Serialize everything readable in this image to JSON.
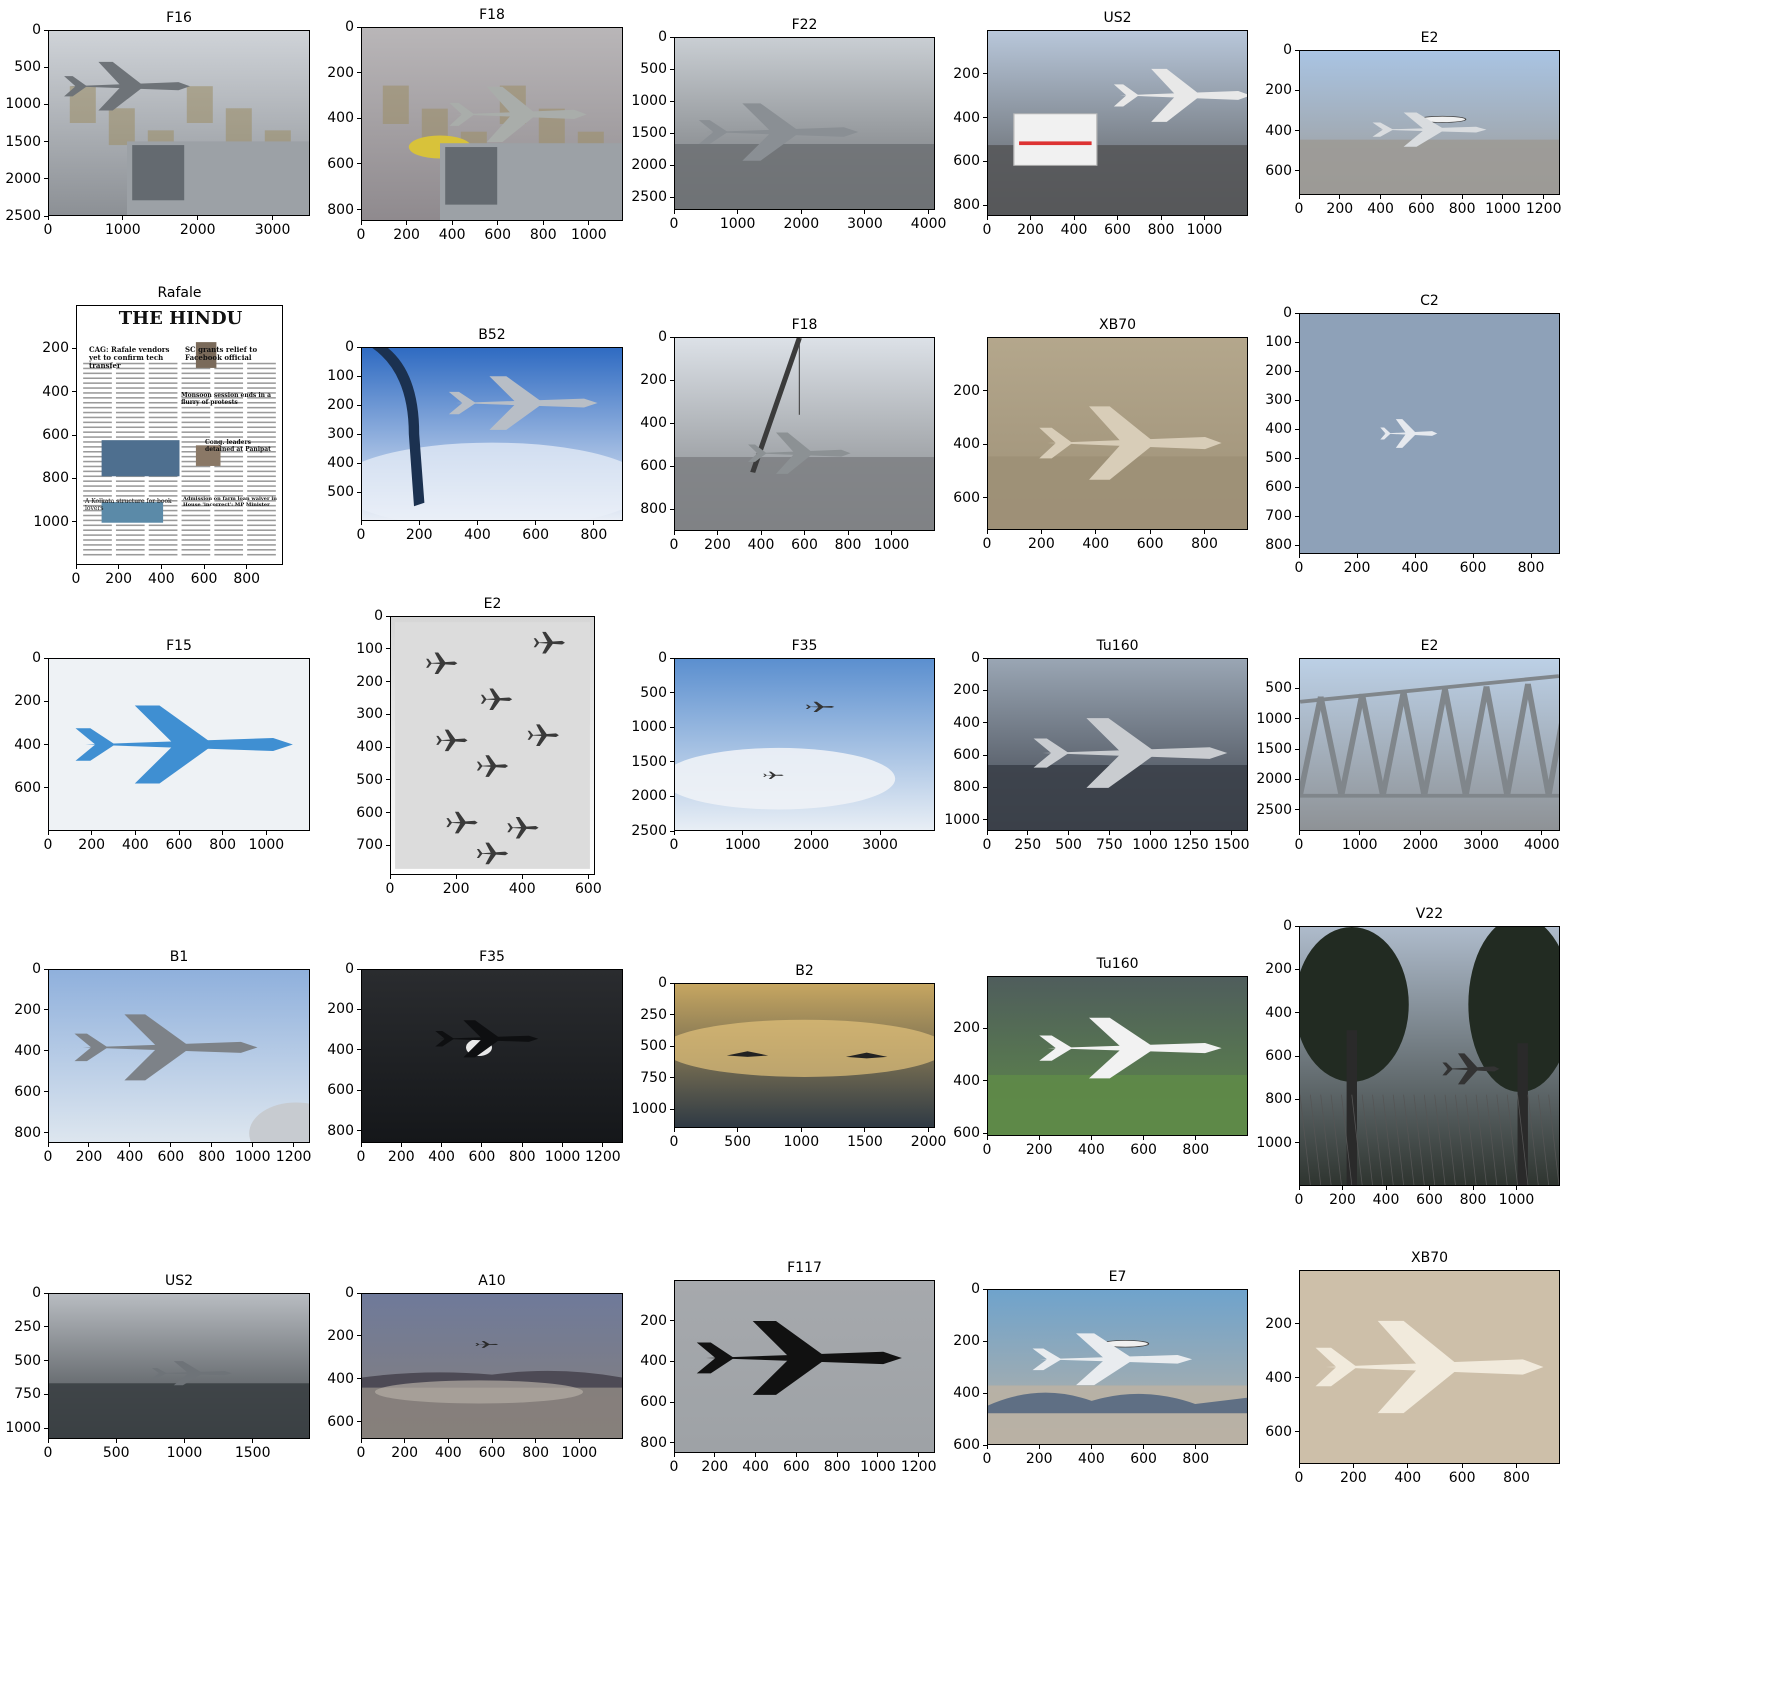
{
  "panels": [
    {
      "title": "F16",
      "x_ticks": [
        "0",
        "1000",
        "2000",
        "3000"
      ],
      "y_ticks": [
        "0",
        "500",
        "1000",
        "1500",
        "2000",
        "2500"
      ],
      "image_size": [
        3500,
        2500
      ],
      "palette": {
        "sky": "#cfd3d8",
        "ground": "#8c9095",
        "subject": "#6e7378"
      },
      "subject": "jet-fighter-in-hangar-icon"
    },
    {
      "title": "F18",
      "x_ticks": [
        "0",
        "200",
        "400",
        "600",
        "800",
        "1000"
      ],
      "y_ticks": [
        "0",
        "200",
        "400",
        "600",
        "800"
      ],
      "image_size": [
        1150,
        850
      ],
      "palette": {
        "sky": "#b9b6b8",
        "ground": "#8f8a8e",
        "subject": "#a9adaa"
      },
      "subject": "jet-assembly-line-icon"
    },
    {
      "title": "F22",
      "x_ticks": [
        "0",
        "1000",
        "2000",
        "3000",
        "4000"
      ],
      "y_ticks": [
        "0",
        "500",
        "1000",
        "1500",
        "2000",
        "2500"
      ],
      "image_size": [
        4100,
        2700
      ],
      "palette": {
        "sky": "#c9ced3",
        "ground": "#6f7275",
        "subject": "#8a8f94"
      },
      "subject": "stealth-fighter-on-runway-icon"
    },
    {
      "title": "US2",
      "x_ticks": [
        "0",
        "200",
        "400",
        "600",
        "800",
        "1000"
      ],
      "y_ticks": [
        "200",
        "400",
        "600",
        "800"
      ],
      "image_size": [
        1200,
        850
      ],
      "palette": {
        "sky": "#b8c7da",
        "ground": "#56585a",
        "subject": "#e8e8e8"
      },
      "subject": "ambulance-and-seaplane-icon"
    },
    {
      "title": "E2",
      "x_ticks": [
        "0",
        "200",
        "400",
        "600",
        "800",
        "1000",
        "1200"
      ],
      "y_ticks": [
        "0",
        "200",
        "400",
        "600"
      ],
      "image_size": [
        1280,
        720
      ],
      "palette": {
        "sky": "#a9c4e3",
        "ground": "#9c9a96",
        "subject": "#d9dcdf"
      },
      "subject": "radar-dome-plane-icon"
    },
    {
      "title": "Rafale",
      "x_ticks": [
        "0",
        "200",
        "400",
        "600",
        "800"
      ],
      "y_ticks": [
        "200",
        "400",
        "600",
        "800",
        "1000"
      ],
      "image_size": [
        970,
        1200
      ],
      "palette": {
        "sky": "#ffffff",
        "ground": "#f2f2f2",
        "subject": "#333333"
      },
      "subject": "newspaper-icon",
      "newspaper": {
        "masthead": "THE HINDU",
        "headline_left": "CAG: Rafale vendors yet to confirm tech transfer",
        "headline_right": "SC grants relief to Facebook official",
        "mid_headline": "Monsoon session ends in a flurry of protests",
        "sub_headline": "Cong. leaders detained at Panipat",
        "lower_left": "A Kolkata structure for book lovers",
        "lower_right": "Admission on farm loan waiver in House 'incorrect': MP Minister"
      }
    },
    {
      "title": "B52",
      "x_ticks": [
        "0",
        "200",
        "400",
        "600",
        "800"
      ],
      "y_ticks": [
        "0",
        "100",
        "200",
        "300",
        "400",
        "500"
      ],
      "image_size": [
        900,
        600
      ],
      "palette": {
        "sky": "#2f6bc2",
        "ground": "#e9eef6",
        "subject": "#b8bec6"
      },
      "subject": "bomber-refuel-icon"
    },
    {
      "title": "F18",
      "x_ticks": [
        "0",
        "200",
        "400",
        "600",
        "800",
        "1000"
      ],
      "y_ticks": [
        "0",
        "200",
        "400",
        "600",
        "800"
      ],
      "image_size": [
        1200,
        900
      ],
      "palette": {
        "sky": "#dce1e7",
        "ground": "#7f8285",
        "subject": "#8c9194"
      },
      "subject": "crane-lifting-jet-icon"
    },
    {
      "title": "XB70",
      "x_ticks": [
        "0",
        "200",
        "400",
        "600",
        "800"
      ],
      "y_ticks": [
        "200",
        "400",
        "600"
      ],
      "image_size": [
        960,
        720
      ],
      "palette": {
        "sky": "#b4a78c",
        "ground": "#9d9077",
        "subject": "#d8cdb8"
      },
      "subject": "xb70-model-icon"
    },
    {
      "title": "C2",
      "x_ticks": [
        "0",
        "200",
        "400",
        "600",
        "800"
      ],
      "y_ticks": [
        "0",
        "100",
        "200",
        "300",
        "400",
        "500",
        "600",
        "700",
        "800"
      ],
      "image_size": [
        900,
        830
      ],
      "palette": {
        "sky": "#8ea1b8",
        "ground": "#8ea1b8",
        "subject": "#e6e9ee"
      },
      "subject": "cargo-plane-icon"
    },
    {
      "title": "F15",
      "x_ticks": [
        "0",
        "200",
        "400",
        "600",
        "800",
        "1000"
      ],
      "y_ticks": [
        "0",
        "200",
        "400",
        "600"
      ],
      "image_size": [
        1200,
        800
      ],
      "palette": {
        "sky": "#eef2f5",
        "ground": "#eef2f5",
        "subject": "#3f8fd2"
      },
      "subject": "blue-fighter-jet-icon"
    },
    {
      "title": "E2",
      "x_ticks": [
        "0",
        "200",
        "400",
        "600"
      ],
      "y_ticks": [
        "0",
        "100",
        "200",
        "300",
        "400",
        "500",
        "600",
        "700"
      ],
      "image_size": [
        620,
        790
      ],
      "palette": {
        "sky": "#d6d6d6",
        "ground": "#ffffff",
        "subject": "#3a3a3a"
      },
      "subject": "formation-planes-icon"
    },
    {
      "title": "F35",
      "x_ticks": [
        "0",
        "1000",
        "2000",
        "3000"
      ],
      "y_ticks": [
        "0",
        "500",
        "1000",
        "1500",
        "2000",
        "2500"
      ],
      "image_size": [
        3800,
        2500
      ],
      "palette": {
        "sky": "#5b8fcf",
        "ground": "#e8eef5",
        "subject": "#333333"
      },
      "subject": "two-jets-in-sky-icon"
    },
    {
      "title": "Tu160",
      "x_ticks": [
        "0",
        "250",
        "500",
        "750",
        "1000",
        "1250",
        "1500"
      ],
      "y_ticks": [
        "0",
        "200",
        "400",
        "600",
        "800",
        "1000"
      ],
      "image_size": [
        1600,
        1070
      ],
      "palette": {
        "sky": "#9aa6b4",
        "ground": "#3b4049",
        "subject": "#c9ccd0"
      },
      "subject": "supersonic-bomber-icon"
    },
    {
      "title": "E2",
      "x_ticks": [
        "0",
        "1000",
        "2000",
        "3000",
        "4000"
      ],
      "y_ticks": [
        "500",
        "1000",
        "1500",
        "2000",
        "2500"
      ],
      "image_size": [
        4300,
        2850
      ],
      "palette": {
        "sky": "#bcd0e6",
        "ground": "#8e9296",
        "subject": "#80868b"
      },
      "subject": "steel-bridge-icon"
    },
    {
      "title": "B1",
      "x_ticks": [
        "0",
        "200",
        "400",
        "600",
        "800",
        "1000",
        "1200"
      ],
      "y_ticks": [
        "0",
        "200",
        "400",
        "600",
        "800"
      ],
      "image_size": [
        1280,
        850
      ],
      "palette": {
        "sky": "#8fb0dc",
        "ground": "#dde6ef",
        "subject": "#7d8288"
      },
      "subject": "swing-wing-bomber-icon"
    },
    {
      "title": "F35",
      "x_ticks": [
        "0",
        "200",
        "400",
        "600",
        "800",
        "1000",
        "1200"
      ],
      "y_ticks": [
        "0",
        "200",
        "400",
        "600",
        "800"
      ],
      "image_size": [
        1300,
        860
      ],
      "palette": {
        "sky": "#2a2c2f",
        "ground": "#15171a",
        "subject": "#ffffff"
      },
      "subject": "night-vtol-jet-icon"
    },
    {
      "title": "B2",
      "x_ticks": [
        "0",
        "500",
        "1000",
        "1500",
        "2000"
      ],
      "y_ticks": [
        "0",
        "250",
        "500",
        "750",
        "1000"
      ],
      "image_size": [
        2050,
        1150
      ],
      "palette": {
        "sky": "#c6a661",
        "ground": "#2f3a44",
        "subject": "#222222"
      },
      "subject": "stealth-bombers-sunset-icon"
    },
    {
      "title": "Tu160",
      "x_ticks": [
        "0",
        "200",
        "400",
        "600",
        "800"
      ],
      "y_ticks": [
        "200",
        "400",
        "600"
      ],
      "image_size": [
        1000,
        610
      ],
      "palette": {
        "sky": "#4f5d5c",
        "ground": "#5e8a48",
        "subject": "#f2f2f2"
      },
      "subject": "white-bomber-museum-icon"
    },
    {
      "title": "V22",
      "x_ticks": [
        "0",
        "200",
        "400",
        "600",
        "800",
        "1000"
      ],
      "y_ticks": [
        "0",
        "200",
        "400",
        "600",
        "800",
        "1000"
      ],
      "image_size": [
        1200,
        1200
      ],
      "palette": {
        "sky": "#aebbcb",
        "ground": "#2f3530",
        "subject": "#222b22"
      },
      "subject": "trees-and-tiltrotor-icon"
    },
    {
      "title": "US2",
      "x_ticks": [
        "0",
        "500",
        "1000",
        "1500"
      ],
      "y_ticks": [
        "0",
        "250",
        "500",
        "750",
        "1000"
      ],
      "image_size": [
        1920,
        1080
      ],
      "palette": {
        "sky": "#b8bcc1",
        "ground": "#3b4044",
        "subject": "#6e7378"
      },
      "subject": "harbor-seaplane-icon"
    },
    {
      "title": "A10",
      "x_ticks": [
        "0",
        "200",
        "400",
        "600",
        "800",
        "1000"
      ],
      "y_ticks": [
        "0",
        "200",
        "400",
        "600"
      ],
      "image_size": [
        1200,
        680
      ],
      "palette": {
        "sky": "#6f7a9a",
        "ground": "#86807b",
        "subject": "#2a2a2a"
      },
      "subject": "desert-low-flying-jet-icon"
    },
    {
      "title": "F117",
      "x_ticks": [
        "0",
        "200",
        "400",
        "600",
        "800",
        "1000",
        "1200"
      ],
      "y_ticks": [
        "200",
        "400",
        "600",
        "800"
      ],
      "image_size": [
        1280,
        850
      ],
      "palette": {
        "sky": "#a6a9ad",
        "ground": "#9ea2a6",
        "subject": "#111111"
      },
      "subject": "stealth-attack-jet-icon"
    },
    {
      "title": "E7",
      "x_ticks": [
        "0",
        "200",
        "400",
        "600",
        "800"
      ],
      "y_ticks": [
        "0",
        "200",
        "400",
        "600"
      ],
      "image_size": [
        1000,
        600
      ],
      "palette": {
        "sky": "#6fa3cc",
        "ground": "#b9b1a4",
        "subject": "#e9ecef"
      },
      "subject": "awacs-jet-icon"
    },
    {
      "title": "XB70",
      "x_ticks": [
        "0",
        "200",
        "400",
        "600",
        "800"
      ],
      "y_ticks": [
        "200",
        "400",
        "600"
      ],
      "image_size": [
        960,
        720
      ],
      "palette": {
        "sky": "#cdbfa9",
        "ground": "#cdbfa9",
        "subject": "#f1eadc"
      },
      "subject": "xb70-landing-icon"
    }
  ]
}
